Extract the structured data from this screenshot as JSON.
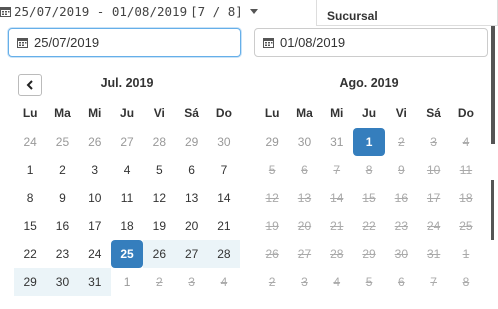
{
  "range_trigger": {
    "label": "25/07/2019 - 01/08/2019",
    "count": "[7 / 8]"
  },
  "sucursal": {
    "label": "Sucursal"
  },
  "start_input": {
    "value": "25/07/2019"
  },
  "end_input": {
    "value": "01/08/2019"
  },
  "weekdays": [
    "Lu",
    "Ma",
    "Mi",
    "Ju",
    "Vi",
    "Sá",
    "Do"
  ],
  "left_calendar": {
    "title": "Jul. 2019",
    "weeks": [
      [
        {
          "d": "24",
          "s": "off"
        },
        {
          "d": "25",
          "s": "off"
        },
        {
          "d": "26",
          "s": "off"
        },
        {
          "d": "27",
          "s": "off"
        },
        {
          "d": "28",
          "s": "off"
        },
        {
          "d": "29",
          "s": "off"
        },
        {
          "d": "30",
          "s": "off"
        }
      ],
      [
        {
          "d": "1",
          "s": ""
        },
        {
          "d": "2",
          "s": ""
        },
        {
          "d": "3",
          "s": ""
        },
        {
          "d": "4",
          "s": ""
        },
        {
          "d": "5",
          "s": ""
        },
        {
          "d": "6",
          "s": ""
        },
        {
          "d": "7",
          "s": ""
        }
      ],
      [
        {
          "d": "8",
          "s": ""
        },
        {
          "d": "9",
          "s": ""
        },
        {
          "d": "10",
          "s": ""
        },
        {
          "d": "11",
          "s": ""
        },
        {
          "d": "12",
          "s": ""
        },
        {
          "d": "13",
          "s": ""
        },
        {
          "d": "14",
          "s": ""
        }
      ],
      [
        {
          "d": "15",
          "s": ""
        },
        {
          "d": "16",
          "s": ""
        },
        {
          "d": "17",
          "s": ""
        },
        {
          "d": "18",
          "s": ""
        },
        {
          "d": "19",
          "s": ""
        },
        {
          "d": "20",
          "s": ""
        },
        {
          "d": "21",
          "s": ""
        }
      ],
      [
        {
          "d": "22",
          "s": ""
        },
        {
          "d": "23",
          "s": ""
        },
        {
          "d": "24",
          "s": ""
        },
        {
          "d": "25",
          "s": "active"
        },
        {
          "d": "26",
          "s": "in-range"
        },
        {
          "d": "27",
          "s": "in-range"
        },
        {
          "d": "28",
          "s": "in-range"
        }
      ],
      [
        {
          "d": "29",
          "s": "in-range"
        },
        {
          "d": "30",
          "s": "in-range"
        },
        {
          "d": "31",
          "s": "in-range"
        },
        {
          "d": "1",
          "s": "off"
        },
        {
          "d": "2",
          "s": "disabled"
        },
        {
          "d": "3",
          "s": "disabled"
        },
        {
          "d": "4",
          "s": "disabled"
        }
      ]
    ]
  },
  "right_calendar": {
    "title": "Ago. 2019",
    "weeks": [
      [
        {
          "d": "29",
          "s": "off"
        },
        {
          "d": "30",
          "s": "off"
        },
        {
          "d": "31",
          "s": "off"
        },
        {
          "d": "1",
          "s": "active"
        },
        {
          "d": "2",
          "s": "disabled"
        },
        {
          "d": "3",
          "s": "disabled"
        },
        {
          "d": "4",
          "s": "disabled"
        }
      ],
      [
        {
          "d": "5",
          "s": "disabled"
        },
        {
          "d": "6",
          "s": "disabled"
        },
        {
          "d": "7",
          "s": "disabled"
        },
        {
          "d": "8",
          "s": "disabled"
        },
        {
          "d": "9",
          "s": "disabled"
        },
        {
          "d": "10",
          "s": "disabled"
        },
        {
          "d": "11",
          "s": "disabled"
        }
      ],
      [
        {
          "d": "12",
          "s": "disabled"
        },
        {
          "d": "13",
          "s": "disabled"
        },
        {
          "d": "14",
          "s": "disabled"
        },
        {
          "d": "15",
          "s": "disabled"
        },
        {
          "d": "16",
          "s": "disabled"
        },
        {
          "d": "17",
          "s": "disabled"
        },
        {
          "d": "18",
          "s": "disabled"
        }
      ],
      [
        {
          "d": "19",
          "s": "disabled"
        },
        {
          "d": "20",
          "s": "disabled"
        },
        {
          "d": "21",
          "s": "disabled"
        },
        {
          "d": "22",
          "s": "disabled"
        },
        {
          "d": "23",
          "s": "disabled"
        },
        {
          "d": "24",
          "s": "disabled"
        },
        {
          "d": "25",
          "s": "disabled"
        }
      ],
      [
        {
          "d": "26",
          "s": "disabled"
        },
        {
          "d": "27",
          "s": "disabled"
        },
        {
          "d": "28",
          "s": "disabled"
        },
        {
          "d": "29",
          "s": "disabled"
        },
        {
          "d": "30",
          "s": "disabled"
        },
        {
          "d": "31",
          "s": "disabled"
        },
        {
          "d": "1",
          "s": "disabled"
        }
      ],
      [
        {
          "d": "2",
          "s": "disabled"
        },
        {
          "d": "3",
          "s": "disabled"
        },
        {
          "d": "4",
          "s": "disabled"
        },
        {
          "d": "5",
          "s": "disabled"
        },
        {
          "d": "6",
          "s": "disabled"
        },
        {
          "d": "7",
          "s": "disabled"
        },
        {
          "d": "8",
          "s": "disabled"
        }
      ]
    ]
  },
  "colors": {
    "active": "#357ebd",
    "in_range": "#ebf4f8",
    "focus_border": "#66afe9"
  }
}
